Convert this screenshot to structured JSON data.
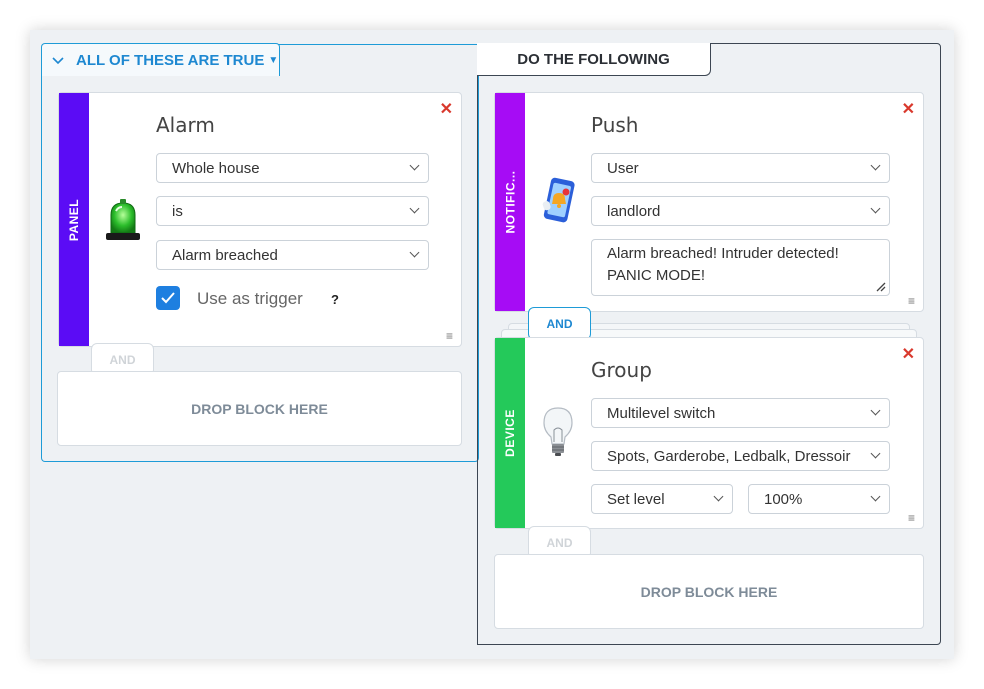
{
  "conditions": {
    "header_label": "ALL OF THESE ARE TRUE",
    "card": {
      "strip_label": "PANEL",
      "title": "Alarm",
      "selects": [
        "Whole house",
        "is",
        "Alarm breached"
      ],
      "trigger_label": "Use as trigger",
      "help_label": "?",
      "icon": "siren-icon"
    },
    "and_label": "AND",
    "drop_label": "DROP BLOCK HERE"
  },
  "actions": {
    "header_label": "DO THE FOLLOWING",
    "push_card": {
      "strip_label": "NOTIFIC...",
      "title": "Push",
      "selects": [
        "User",
        "landlord"
      ],
      "message": "Alarm breached! Intruder detected! PANIC MODE!",
      "icon": "phone-notification-icon"
    },
    "and_label": "AND",
    "device_card": {
      "strip_label": "DEVICE",
      "title": "Group",
      "selects": [
        "Multilevel switch",
        "Spots, Garderobe, Ledbalk, Dressoir"
      ],
      "level_action": "Set level",
      "level_value": "100%",
      "icon": "light-bulb-icon"
    },
    "and_label_2": "AND",
    "drop_label": "DROP BLOCK HERE"
  },
  "colors": {
    "panel_strip": "#5b0cf5",
    "notification_strip": "#a60cf5",
    "device_strip": "#24c95a",
    "accent": "#1e88d1",
    "close": "#d9382c"
  }
}
